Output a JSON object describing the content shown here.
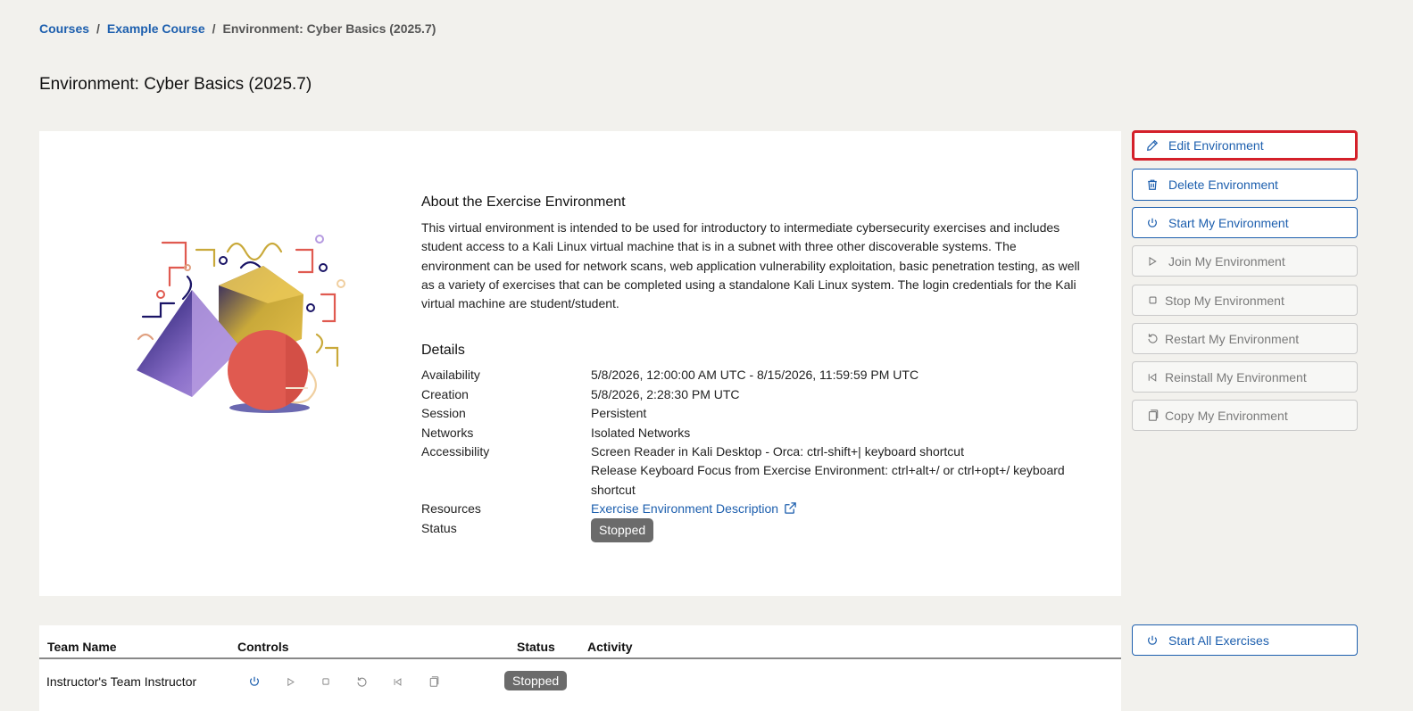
{
  "breadcrumb": {
    "items": [
      "Courses",
      "Example Course"
    ],
    "current": "Environment: Cyber Basics (2025.7)",
    "separator": "/"
  },
  "page_title": "Environment: Cyber Basics (2025.7)",
  "about": {
    "title": "About the Exercise Environment",
    "text": "This virtual environment is intended to be used for introductory to intermediate cybersecurity exercises and includes student access to a Kali Linux virtual machine that is in a subnet with three other discoverable systems. The environment can be used for network scans, web application vulnerability exploitation, basic penetration testing, as well as a variety of exercises that can be completed using a standalone Kali Linux system. The login credentials for the Kali virtual machine are student/student."
  },
  "details": {
    "title": "Details",
    "rows": [
      {
        "label": "Availability",
        "value": "5/8/2026, 12:00:00 AM UTC - 8/15/2026, 11:59:59 PM UTC"
      },
      {
        "label": "Creation",
        "value": "5/8/2026, 2:28:30 PM UTC"
      },
      {
        "label": "Session",
        "value": "Persistent"
      },
      {
        "label": "Networks",
        "value": "Isolated Networks"
      },
      {
        "label": "Accessibility",
        "value": "Screen Reader in Kali Desktop - Orca: ctrl-shift+| keyboard shortcut",
        "value2": "Release Keyboard Focus from Exercise Environment: ctrl+alt+/ or ctrl+opt+/ keyboard shortcut"
      },
      {
        "label": "Resources",
        "value": "Exercise Environment Description"
      },
      {
        "label": "Status",
        "value": "Stopped"
      }
    ]
  },
  "actions": {
    "edit": "Edit Environment",
    "delete": "Delete Environment",
    "start": "Start My Environment",
    "join": "Join My Environment",
    "stop": "Stop My Environment",
    "restart": "Restart My Environment",
    "reinstall": "Reinstall My Environment",
    "copy": "Copy My Environment",
    "start_all": "Start All Exercises"
  },
  "icons": {
    "edit": "pencil-icon",
    "delete": "trash-icon",
    "start": "power-icon",
    "join": "play-icon",
    "stop": "stop-icon",
    "restart": "restart-icon",
    "reinstall": "skip-back-icon",
    "copy": "copy-icon",
    "external": "external-link-icon"
  },
  "table": {
    "headers": [
      "Team Name",
      "Controls",
      "Status",
      "Activity"
    ],
    "rows": [
      {
        "team": "Instructor's Team Instructor",
        "status": "Stopped",
        "activity": ""
      }
    ]
  },
  "colors": {
    "link": "#1d5fae",
    "highlight": "#d4202a",
    "badge": "#6b6b6b",
    "background": "#f2f1ed"
  }
}
